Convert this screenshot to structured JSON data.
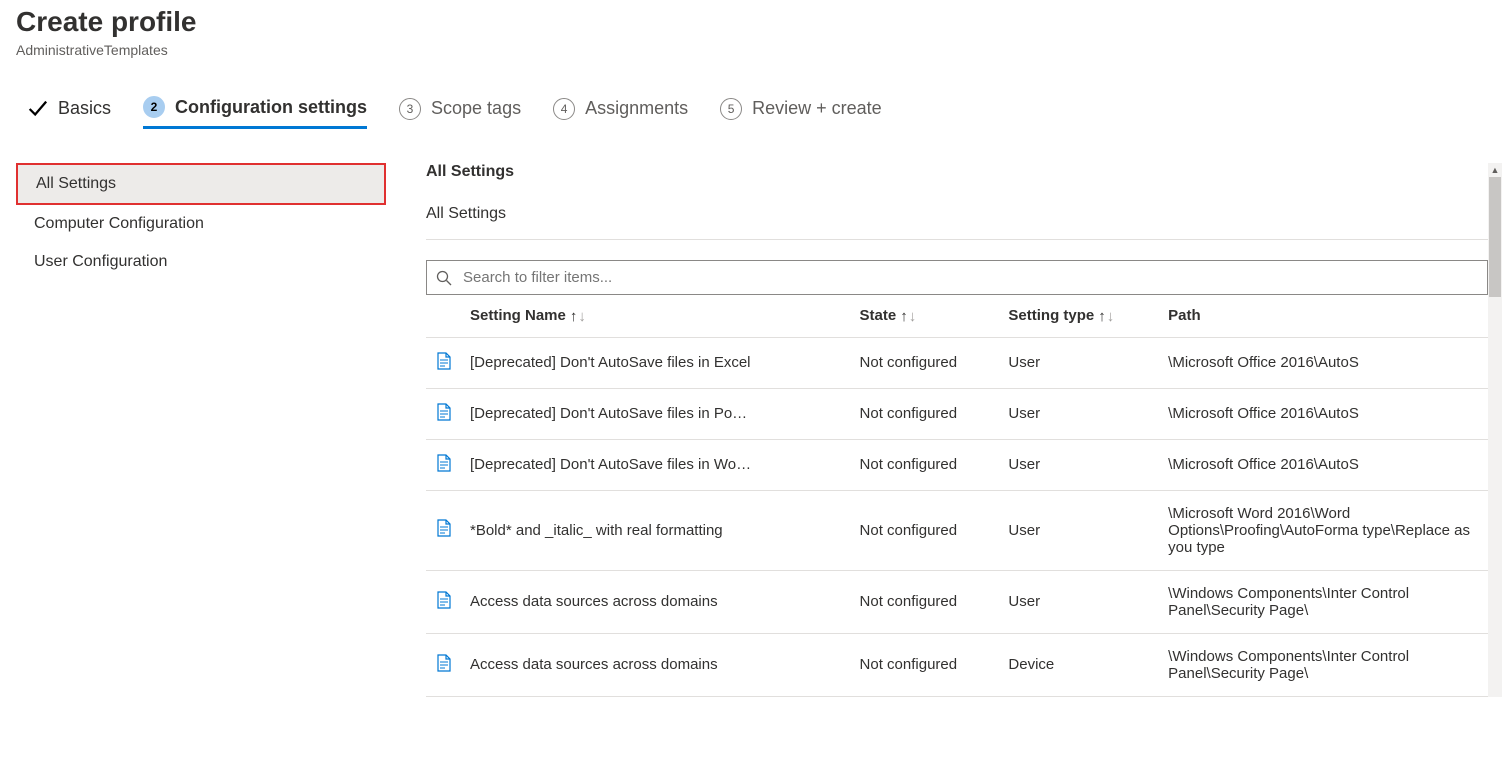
{
  "pageTitle": "Create profile",
  "pageSubtitle": "AdministrativeTemplates",
  "tabs": {
    "basics": "Basics",
    "config": "Configuration settings",
    "scope": "Scope tags",
    "assign": "Assignments",
    "review": "Review + create",
    "num2": "2",
    "num3": "3",
    "num4": "4",
    "num5": "5"
  },
  "sidebar": {
    "items": [
      "All Settings",
      "Computer Configuration",
      "User Configuration"
    ]
  },
  "main": {
    "sectionTitle": "All Settings",
    "breadcrumb": "All Settings",
    "searchPlaceholder": "Search to filter items...",
    "columns": {
      "name": "Setting Name",
      "state": "State",
      "type": "Setting type",
      "path": "Path"
    },
    "rows": [
      {
        "name": "[Deprecated] Don't AutoSave files in Excel",
        "state": "Not configured",
        "type": "User",
        "path": "\\Microsoft Office 2016\\AutoS"
      },
      {
        "name": "[Deprecated] Don't AutoSave files in Po…",
        "state": "Not configured",
        "type": "User",
        "path": "\\Microsoft Office 2016\\AutoS"
      },
      {
        "name": "[Deprecated] Don't AutoSave files in Wo…",
        "state": "Not configured",
        "type": "User",
        "path": "\\Microsoft Office 2016\\AutoS"
      },
      {
        "name": "*Bold* and _italic_ with real formatting",
        "state": "Not configured",
        "type": "User",
        "path": "\\Microsoft Word 2016\\Word Options\\Proofing\\AutoForma type\\Replace as you type"
      },
      {
        "name": "Access data sources across domains",
        "state": "Not configured",
        "type": "User",
        "path": "\\Windows Components\\Inter Control Panel\\Security Page\\"
      },
      {
        "name": "Access data sources across domains",
        "state": "Not configured",
        "type": "Device",
        "path": "\\Windows Components\\Inter Control Panel\\Security Page\\"
      }
    ]
  }
}
